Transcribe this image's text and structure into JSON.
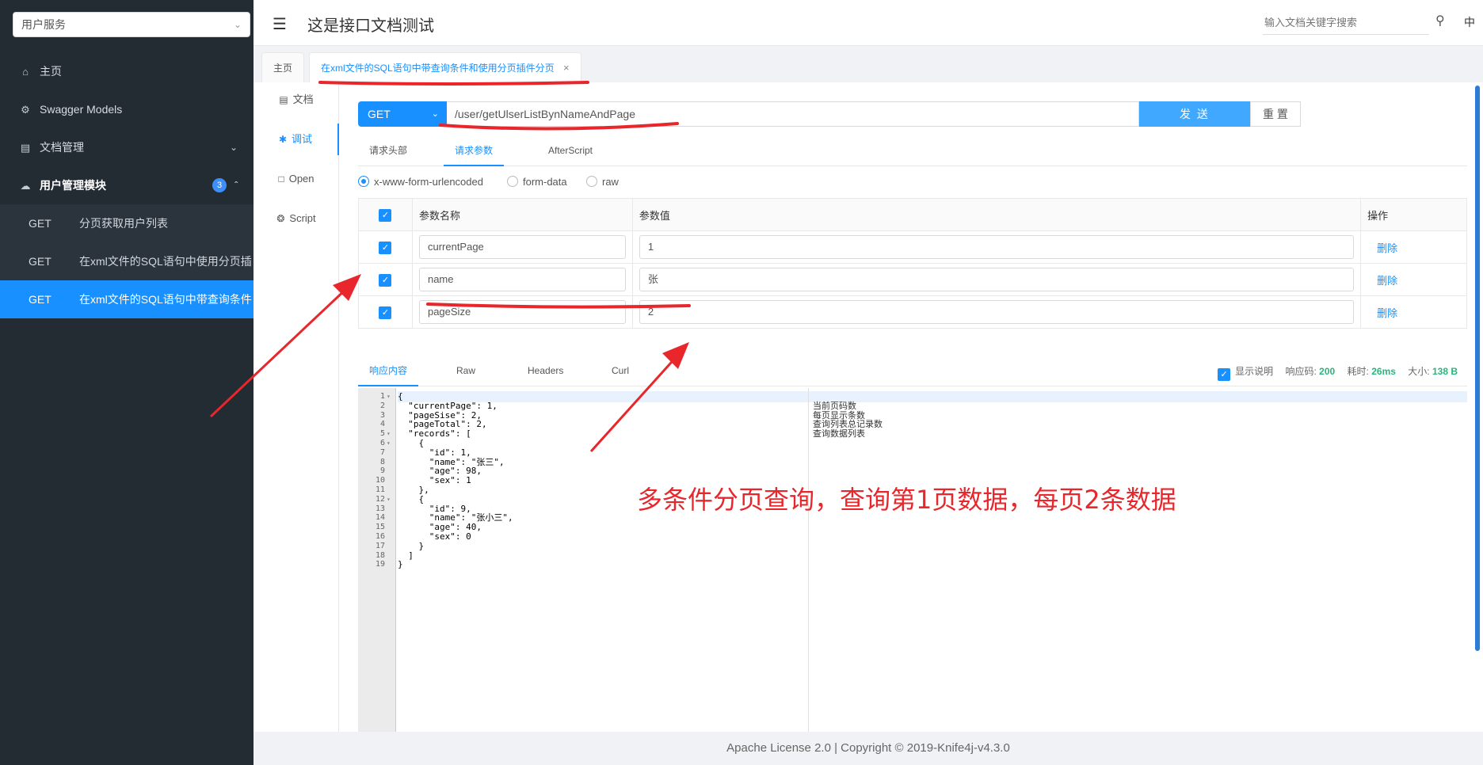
{
  "sidebar": {
    "service_select": "用户服务",
    "menu": [
      {
        "label": "主页",
        "icon": "home-icon"
      },
      {
        "label": "Swagger Models",
        "icon": "gear-icon"
      },
      {
        "label": "文档管理",
        "icon": "doc-icon"
      }
    ],
    "group": {
      "label": "用户管理模块",
      "badge": "3",
      "icon": "cloud-icon"
    },
    "items": [
      {
        "method": "GET",
        "name": "分页获取用户列表"
      },
      {
        "method": "GET",
        "name": "在xml文件的SQL语句中使用分页插"
      },
      {
        "method": "GET",
        "name": "在xml文件的SQL语句中带查询条件"
      }
    ]
  },
  "header": {
    "title": "这是接口文档测试",
    "search_placeholder": "输入文档关键字搜索",
    "lang": "中"
  },
  "page_tabs": [
    {
      "label": "主页"
    },
    {
      "label": "在xml文件的SQL语句中带查询条件和使用分页插件分页",
      "close": "×"
    }
  ],
  "vtabs": [
    "文档",
    "调试",
    "Open",
    "Script"
  ],
  "request": {
    "method": "GET",
    "url": "/user/getUlserListBynNameAndPage",
    "send": "发 送",
    "reset": "重 置",
    "tabs": [
      "请求头部",
      "请求参数",
      "AfterScript"
    ],
    "content_types": [
      "x-www-form-urlencoded",
      "form-data",
      "raw"
    ],
    "table_headers": {
      "name": "参数名称",
      "value": "参数值",
      "op": "操作"
    },
    "params": [
      {
        "name": "currentPage",
        "value": "1",
        "op": "删除"
      },
      {
        "name": "name",
        "value": "张",
        "op": "删除"
      },
      {
        "name": "pageSize",
        "value": "2",
        "op": "删除"
      }
    ]
  },
  "response": {
    "tabs": [
      "响应内容",
      "Raw",
      "Headers",
      "Curl"
    ],
    "show_desc": "显示说明",
    "code_label": "响应码:",
    "code": "200",
    "time_label": "耗时:",
    "time": "26ms",
    "size_label": "大小:",
    "size": "138 B",
    "lines": [
      "{",
      "  \"currentPage\": 1,",
      "  \"pageSise\": 2,",
      "  \"pageTotal\": 2,",
      "  \"records\": [",
      "    {",
      "      \"id\": 1,",
      "      \"name\": \"张三\",",
      "      \"age\": 98,",
      "      \"sex\": 1",
      "    },",
      "    {",
      "      \"id\": 9,",
      "      \"name\": \"张小三\",",
      "      \"age\": 40,",
      "      \"sex\": 0",
      "    }",
      "  ]",
      "}"
    ],
    "line_numbers": [
      "1",
      "2",
      "3",
      "4",
      "5",
      "6",
      "7",
      "8",
      "9",
      "10",
      "11",
      "12",
      "13",
      "14",
      "15",
      "16",
      "17",
      "18",
      "19"
    ],
    "descriptions": [
      "当前页码数",
      "每页显示条数",
      "查询列表总记录数",
      "查询数据列表"
    ]
  },
  "annotation": "多条件分页查询，查询第1页数据，每页2条数据",
  "footer": "Apache License 2.0 | Copyright © 2019-Knife4j-v4.3.0",
  "colors": {
    "accent": "#1890ff",
    "sidebar": "#232b33",
    "annotation": "#e8262b"
  }
}
